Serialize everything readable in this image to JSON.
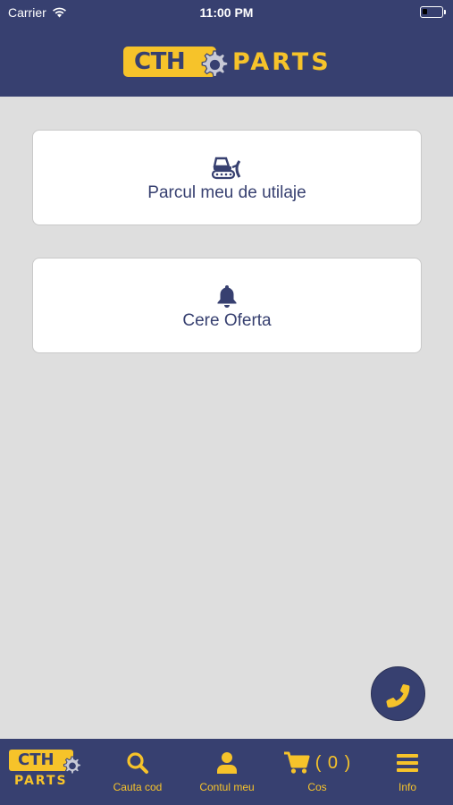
{
  "status_bar": {
    "carrier": "Carrier",
    "time": "11:00 PM"
  },
  "header": {
    "logo_cth": "CTH",
    "logo_parts": "PARTS"
  },
  "cards": {
    "fleet": {
      "label": "Parcul meu de utilaje",
      "icon": "bulldozer-icon"
    },
    "offer": {
      "label": "Cere Oferta",
      "icon": "bell-icon"
    }
  },
  "fab": {
    "icon": "phone-icon"
  },
  "tab_bar": {
    "logo_cth": "CTH",
    "logo_parts": "PARTS",
    "search_label": "Cauta cod",
    "account_label": "Contul meu",
    "cart_label": "Cos",
    "cart_count": "( 0 )",
    "info_label": "Info"
  },
  "colors": {
    "primary": "#374070",
    "accent": "#f6c32a",
    "background": "#dedede",
    "card": "#ffffff"
  }
}
